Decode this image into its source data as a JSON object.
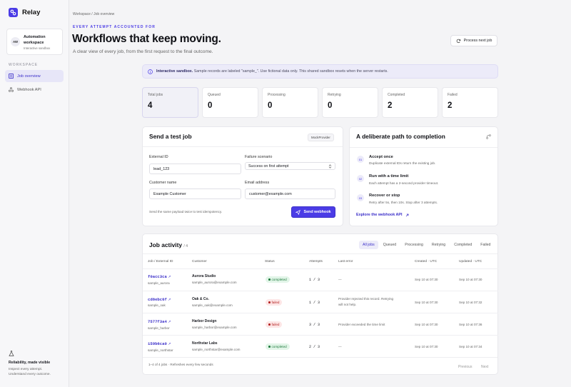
{
  "app": {
    "name": "Relay"
  },
  "workspace": {
    "initials": "AW",
    "name": "Automation workspace",
    "subtitle": "Interactive sandbox"
  },
  "nav": {
    "section": "WORKSPACE",
    "items": [
      {
        "label": "Job overview"
      },
      {
        "label": "Webhook API"
      }
    ]
  },
  "sidebar_footer": {
    "title": "Reliability, made visible",
    "line1": "Inspect every attempt.",
    "line2": "Understand every outcome."
  },
  "header": {
    "breadcrumb": "Workspace / Job overview",
    "eyebrow": "EVERY ATTEMPT ACCOUNTED FOR",
    "title": "Workflows that keep moving.",
    "subtitle": "A clear view of every job, from the first request to the final outcome.",
    "action_label": "Process next job"
  },
  "banner": {
    "strong": "Interactive sandbox.",
    "text": " Sample records are labeled \"sample_\". Use fictional data only. This shared sandbox resets when the server restarts."
  },
  "stats": [
    {
      "label": "Total jobs",
      "value": "4"
    },
    {
      "label": "Queued",
      "value": "0"
    },
    {
      "label": "Processing",
      "value": "0"
    },
    {
      "label": "Retrying",
      "value": "0"
    },
    {
      "label": "Completed",
      "value": "2"
    },
    {
      "label": "Failed",
      "value": "2"
    }
  ],
  "test_job": {
    "title": "Send a test job",
    "provider_chip": "MockProvider",
    "external_id_label": "External ID",
    "external_id_value": "lead_123",
    "failure_label": "Failure scenario",
    "failure_value": "Success on first attempt",
    "customer_name_label": "Customer name",
    "customer_name_value": "Example Customer",
    "email_label": "Email address",
    "email_value": "customer@example.com",
    "hint": "Send the same payload twice to test idempotency.",
    "send_label": "Send webhook"
  },
  "path": {
    "title": "A deliberate path to completion",
    "steps": [
      {
        "num": "01",
        "title": "Accept once",
        "text": "Duplicate external IDs return the existing job."
      },
      {
        "num": "02",
        "title": "Run with a time limit",
        "text": "Each attempt has a 2-second provider timeout."
      },
      {
        "num": "03",
        "title": "Recover or stop",
        "text": "Retry after 5s, then 10s. Stop after 3 attempts."
      }
    ],
    "link_label": "Explore the webhook API"
  },
  "activity": {
    "title": "Job activity",
    "count": "/ 4",
    "tabs": [
      "All jobs",
      "Queued",
      "Processing",
      "Retrying",
      "Completed",
      "Failed"
    ],
    "columns": [
      "Job / External ID",
      "Customer",
      "Status",
      "Attempts",
      "Last error",
      "Created · UTC",
      "Updated · UTC"
    ],
    "rows": [
      {
        "job_id": "f0acc3ca",
        "external_id": "sample_aurora",
        "customer": "Aurora Studio",
        "email": "sample_aurora@example.com",
        "status": "completed",
        "attempts": "1 / 3",
        "error": "—",
        "error2": "",
        "created": "Sep 10 at 07:30",
        "updated": "Sep 10 at 07:30"
      },
      {
        "job_id": "cd8ebc6f",
        "external_id": "sample_oak",
        "customer": "Oak & Co.",
        "email": "sample_oak@example.com",
        "status": "failed",
        "attempts": "1 / 3",
        "error": "Provider rejected this record. Retrying",
        "error2": "will not help.",
        "created": "Sep 10 at 07:30",
        "updated": "Sep 10 at 07:32"
      },
      {
        "job_id": "7577f3a4",
        "external_id": "sample_harbor",
        "customer": "Harbor Design",
        "email": "sample_harbor@example.com",
        "status": "failed",
        "attempts": "3 / 3",
        "error": "Provider exceeded the time limit",
        "error2": "",
        "created": "Sep 10 at 07:30",
        "updated": "Sep 10 at 07:36"
      },
      {
        "job_id": "159b6ca0",
        "external_id": "sample_northstar",
        "customer": "Northstar Labs",
        "email": "sample_northstar@example.com",
        "status": "completed",
        "attempts": "2 / 3",
        "error": "—",
        "error2": "",
        "created": "Sep 10 at 07:30",
        "updated": "Sep 10 at 07:34"
      }
    ],
    "footer": "1–4 of 4 jobs · Refreshes every few seconds",
    "prev": "Previous",
    "next": "Next"
  },
  "colors": {
    "accent": "#4b3ce6",
    "completed": "#1f7a3d",
    "failed": "#b42323"
  }
}
